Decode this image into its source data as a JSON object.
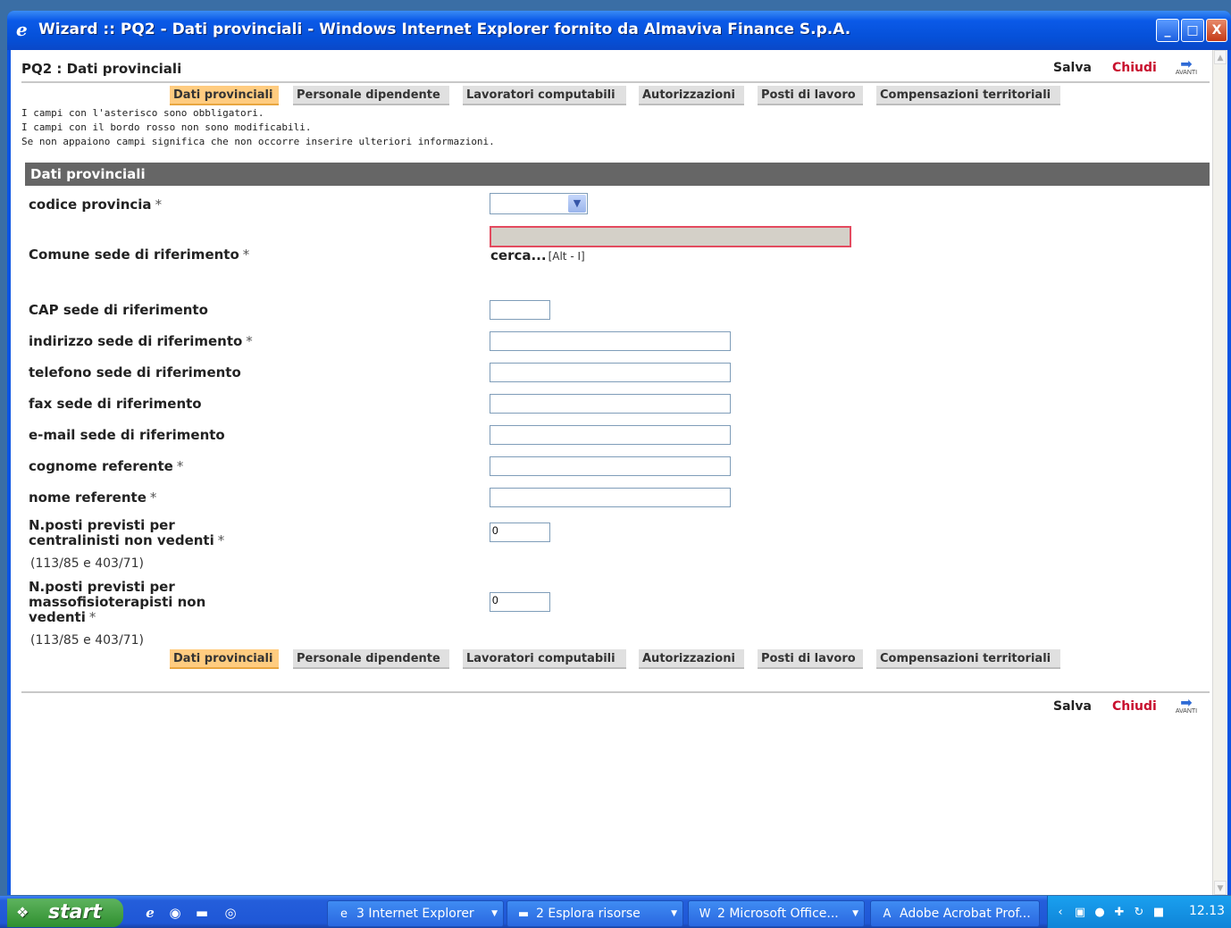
{
  "window": {
    "title": "Wizard :: PQ2 - Dati provinciali - Windows Internet Explorer fornito da Almaviva Finance S.p.A.",
    "controls": {
      "minimize": "_",
      "maximize": "□",
      "close": "X"
    }
  },
  "page": {
    "title": "PQ2 : Dati provinciali",
    "actions": {
      "save": "Salva",
      "close": "Chiudi",
      "next": "AVANTI"
    },
    "tabs": [
      {
        "label": "Dati provinciali",
        "active": true
      },
      {
        "label": "Personale dipendente"
      },
      {
        "label": "Lavoratori computabili"
      },
      {
        "label": "Autorizzazioni"
      },
      {
        "label": "Posti di lavoro"
      },
      {
        "label": "Compensazioni territoriali"
      }
    ],
    "notes": [
      "I campi con l'asterisco sono obbligatori.",
      "I campi con il bordo rosso non sono modificabili.",
      "Se non appaiono campi significa che non occorre inserire ulteriori informazioni."
    ],
    "section_title": "Dati provinciali"
  },
  "form": {
    "codice_provincia": {
      "label": "codice provincia",
      "required": "*",
      "value": ""
    },
    "comune": {
      "label": "Comune sede di riferimento",
      "required": "*",
      "value": "",
      "search_label": "cerca...",
      "search_shortcut": "[Alt - I]"
    },
    "cap": {
      "label": "CAP sede di riferimento",
      "value": ""
    },
    "indirizzo": {
      "label": "indirizzo sede di riferimento",
      "required": "*",
      "value": ""
    },
    "telefono": {
      "label": "telefono sede di riferimento",
      "value": ""
    },
    "fax": {
      "label": "fax sede di riferimento",
      "value": ""
    },
    "email": {
      "label": "e-mail sede di riferimento",
      "value": ""
    },
    "cognome": {
      "label": "cognome referente",
      "required": "*",
      "value": ""
    },
    "nome": {
      "label": "nome referente",
      "required": "*",
      "value": ""
    },
    "centralinisti": {
      "label_l1": "N.posti previsti per",
      "label_l2": "centralinisti non vedenti",
      "required": "*",
      "note": "(113/85 e 403/71)",
      "value": "0"
    },
    "massofisioterapisti": {
      "label_l1": "N.posti previsti per",
      "label_l2": "massofisioterapisti non",
      "label_l3": "vedenti",
      "required": "*",
      "note": "(113/85 e 403/71)",
      "value": "0"
    }
  },
  "taskbar": {
    "start": "start",
    "quick_launch": [
      "ie-icon",
      "ie-alt-icon",
      "folder-icon",
      "media-icon"
    ],
    "buttons": [
      {
        "label": "3 Internet Explorer",
        "icon": "ie-icon"
      },
      {
        "label": "2 Esplora risorse",
        "icon": "folder-icon"
      },
      {
        "label": "2 Microsoft Office...",
        "icon": "word-icon"
      },
      {
        "label": "Adobe Acrobat Prof...",
        "icon": "acrobat-icon"
      }
    ],
    "clock": "12.13"
  },
  "colors": {
    "active_tab": "#ffcc80",
    "tab": "#e0e0e0",
    "section_header": "#666666",
    "close_link": "#c8102e",
    "readonly_border": "#e34a5f"
  }
}
